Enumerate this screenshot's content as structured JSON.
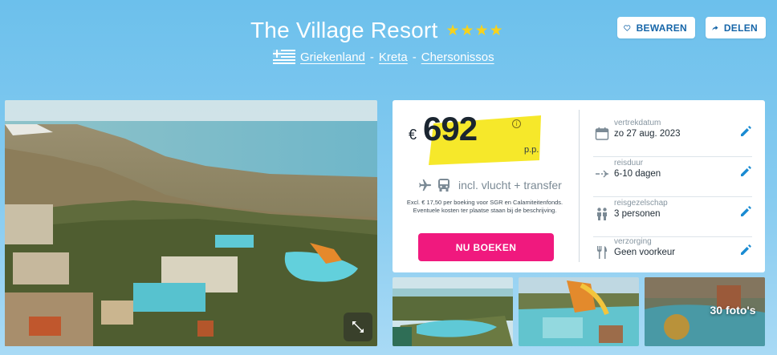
{
  "header": {
    "title": "The Village Resort",
    "rating_stars": 4,
    "star_glyph": "★",
    "location": {
      "flag_icon": "greece-flag-icon",
      "country": "Griekenland",
      "region": "Kreta",
      "city": "Chersonissos",
      "separator": "-"
    },
    "save_button": {
      "label": "BEWAREN",
      "icon": "heart-outline-icon"
    },
    "share_button": {
      "label": "DELEN",
      "icon": "share-arrow-icon"
    }
  },
  "gallery": {
    "expand_icon": "expand-arrows-icon",
    "more_photos_label": "30 foto's"
  },
  "booking": {
    "currency": "€",
    "price": "692",
    "per_person": "p.p.",
    "info_icon": "i",
    "transport_icons": [
      "plane-icon",
      "bus-icon"
    ],
    "inclusion": "incl. vlucht + transfer",
    "fine_print": "Excl. € 17,50 per boeking voor SGR en Calamiteitenfonds. Eventuele kosten ter plaatse staan bij de beschrijving.",
    "book_button": "NU BOEKEN"
  },
  "details": [
    {
      "icon": "calendar-icon",
      "label": "vertrekdatum",
      "value": "zo 27 aug. 2023"
    },
    {
      "icon": "flight-duration-icon",
      "label": "reisduur",
      "value": "6-10 dagen"
    },
    {
      "icon": "people-icon",
      "label": "reisgezelschap",
      "value": "3 personen"
    },
    {
      "icon": "cutlery-icon",
      "label": "verzorging",
      "value": "Geen voorkeur"
    }
  ],
  "colors": {
    "accent_pink": "#f0197e",
    "brand_blue": "#1565a8",
    "price_highlight": "#f6e82a",
    "star_yellow": "#f7d21c"
  }
}
